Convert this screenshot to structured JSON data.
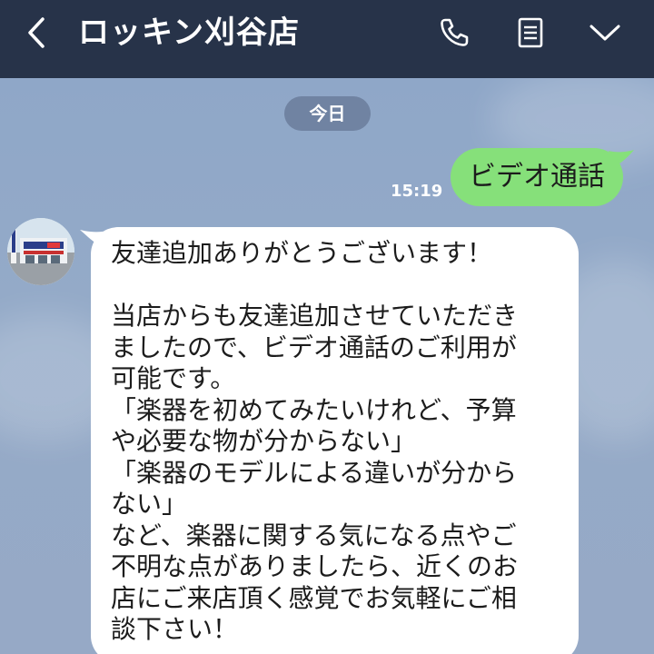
{
  "header": {
    "title": "ロッキン刈谷店",
    "icons": [
      "back-chevron-icon",
      "phone-icon",
      "notes-icon",
      "chevron-down-icon"
    ]
  },
  "chat": {
    "date_label": "今日",
    "outgoing": {
      "text": "ビデオ通話",
      "time": "15:19"
    },
    "incoming": {
      "text": "友達追加ありがとうございます！\n\n当店からも友達追加させていただき\nましたので、ビデオ通話のご利用が\n可能です。\n「楽器を初めてみたいけれど、予算\nや必要な物が分からない」\n「楽器のモデルによる違いが分から\nない」\nなど、楽器に関する気になる点やご\n不明な点がありましたら、近くのお\n店にご来店頂く感覚でお気軽にご相\n談下さい！"
    }
  },
  "colors": {
    "header_bg": "#273349",
    "chat_bg": "#8ea4c4",
    "outgoing_bubble": "#86e07a",
    "incoming_bubble": "#ffffff",
    "date_pill": "#7083a2"
  }
}
